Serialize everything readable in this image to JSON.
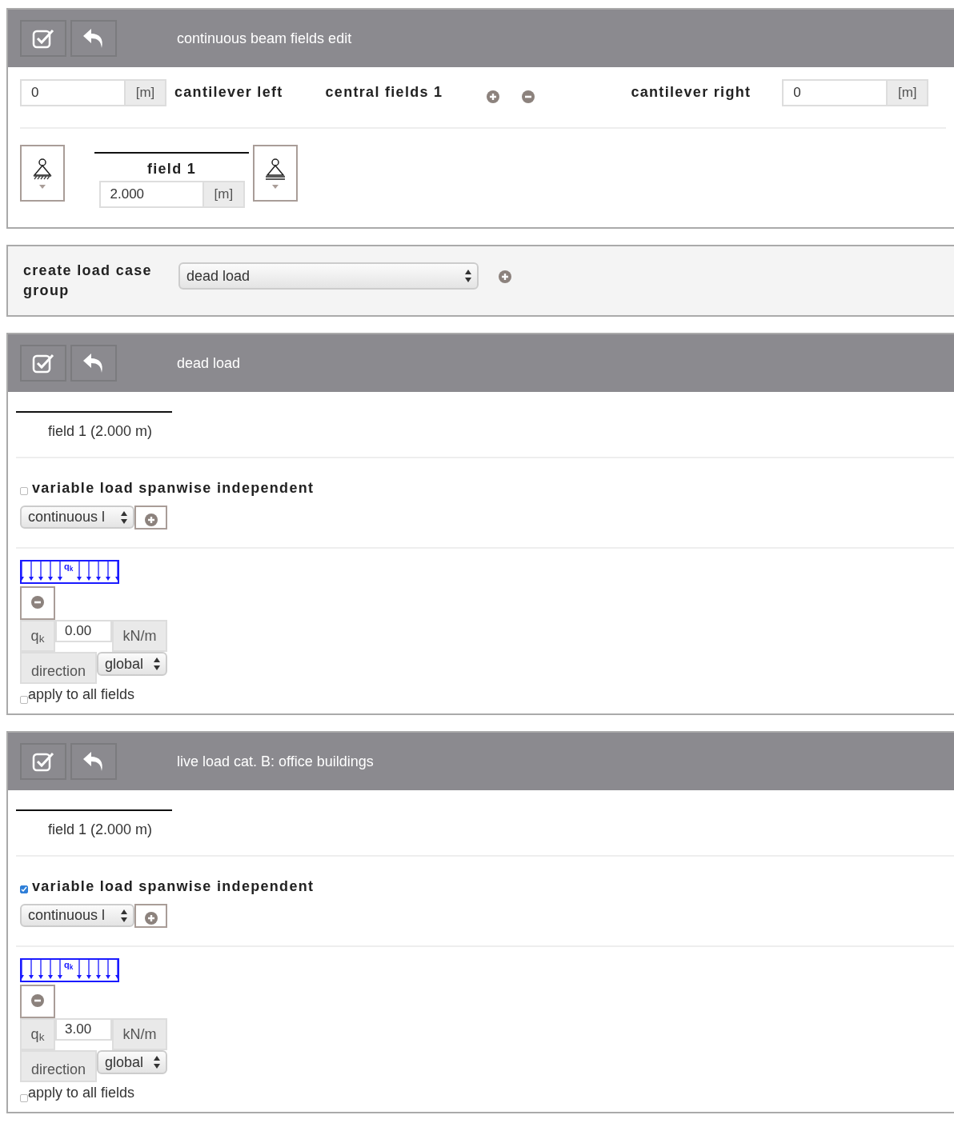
{
  "beam_panel": {
    "title": "continuous beam fields edit",
    "cantilever_left": {
      "value": "0",
      "unit": "[m]",
      "label": "cantilever left"
    },
    "central_fields": {
      "label": "central fields 1"
    },
    "cantilever_right": {
      "label": "cantilever right",
      "value": "0",
      "unit": "[m]"
    },
    "supports": [
      {
        "kind": "fixed"
      },
      {
        "kind": "roller"
      }
    ],
    "fields": [
      {
        "label": "field 1",
        "value": "2.000",
        "unit": "[m]"
      }
    ]
  },
  "load_case_group": {
    "label": "create load case group",
    "value": "dead load"
  },
  "load_cases": [
    {
      "title": "dead load",
      "field_label": "field 1 (2.000 m)",
      "spanwise_independent": {
        "label": "variable load spanwise independent",
        "checked": false
      },
      "load_type": "continuous l",
      "load_symbol": "q$_{k}$",
      "value_label": "q$_{k}$",
      "value": "0.00",
      "unit": "kN/m",
      "direction_label": "direction",
      "direction": "global",
      "apply_all": {
        "label": "apply to all fields",
        "checked": false
      }
    },
    {
      "title": "live load cat. B: office buildings",
      "field_label": "field 1 (2.000 m)",
      "spanwise_independent": {
        "label": "variable load spanwise independent",
        "checked": true
      },
      "load_type": "continuous l",
      "load_symbol": "q$_{k}$",
      "value_label": "q$_{k}$",
      "value": "3.00",
      "unit": "kN/m",
      "direction_label": "direction",
      "direction": "global",
      "apply_all": {
        "label": "apply to all fields",
        "checked": false
      }
    }
  ]
}
